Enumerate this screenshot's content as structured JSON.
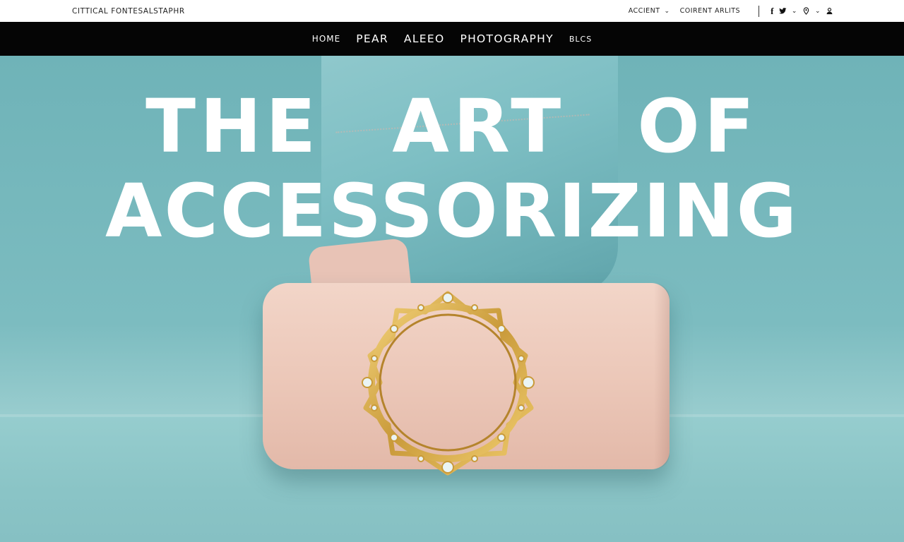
{
  "topbar": {
    "brand": "CITTICAL FONTESALSTAPHR",
    "links": [
      {
        "label": "ACCIENT",
        "icon": "chevron-down-icon"
      },
      {
        "label": "COIRENT ARLITS"
      }
    ],
    "social_icons": [
      "facebook-icon",
      "twitter-icon",
      "chevron-down-icon",
      "location-pin-icon",
      "chevron-down-icon",
      "user-icon"
    ]
  },
  "nav": {
    "items": [
      {
        "label": "HOME",
        "size": "small"
      },
      {
        "label": "PEAR",
        "size": "large"
      },
      {
        "label": "ALEEO",
        "size": "large"
      },
      {
        "label": "PHOTOGRAPHY",
        "size": "large"
      },
      {
        "label": "BLCS",
        "size": "small"
      }
    ]
  },
  "hero": {
    "title_line1": "THE ART OF",
    "title_line2": "ACCESSORIZING",
    "colors": {
      "background": "#7bbcc0",
      "text": "#ffffff",
      "clutch": "#ecc8b9",
      "gold": "#d4a84a"
    }
  }
}
